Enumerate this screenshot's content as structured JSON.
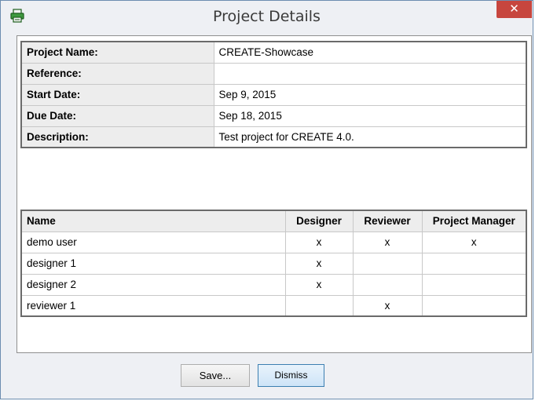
{
  "window": {
    "title": "Project Details",
    "close_label": "✕"
  },
  "project": {
    "fields": [
      {
        "label": "Project Name:",
        "value": "CREATE-Showcase"
      },
      {
        "label": "Reference:",
        "value": ""
      },
      {
        "label": "Start Date:",
        "value": "Sep 9, 2015"
      },
      {
        "label": "Due Date:",
        "value": "Sep 18, 2015"
      },
      {
        "label": "Description:",
        "value": "Test project for CREATE 4.0."
      }
    ]
  },
  "members": {
    "headers": [
      "Name",
      "Designer",
      "Reviewer",
      "Project Manager"
    ],
    "rows": [
      [
        "demo user",
        "x",
        "x",
        "x"
      ],
      [
        "designer 1",
        "x",
        "",
        ""
      ],
      [
        "designer 2",
        "x",
        "",
        ""
      ],
      [
        "reviewer 1",
        "",
        "x",
        ""
      ]
    ]
  },
  "buttons": {
    "save": "Save...",
    "dismiss": "Dismiss"
  },
  "colors": {
    "close": "#c7463e",
    "window_border": "#6c8db0",
    "dismiss_border": "#3c7fb1"
  },
  "icons": {
    "app": "printer-icon",
    "close": "close-icon"
  }
}
